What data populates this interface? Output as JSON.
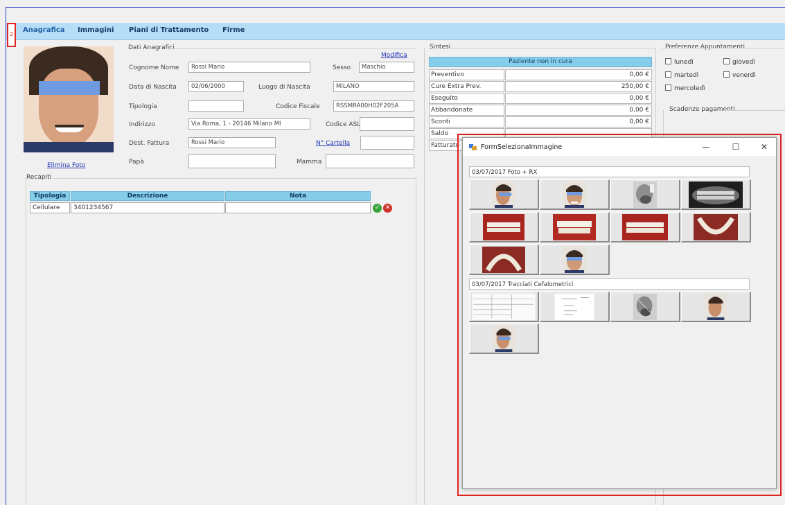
{
  "tabs": {
    "marker": "2",
    "items": [
      "Anagrafica",
      "Immagini",
      "Piani di Trattamento",
      "Firme"
    ]
  },
  "photo": {
    "delete_label": "Elimina Foto"
  },
  "anagrafica": {
    "group_label": "Dati Anagrafici",
    "edit_link": "Modifica",
    "cognome_nome_label": "Cognome Nome",
    "cognome_nome_value": "Rossi Mario",
    "sesso_label": "Sesso",
    "sesso_value": "Maschio",
    "data_nascita_label": "Data di Nascita",
    "data_nascita_value": "02/06/2000",
    "luogo_nascita_label": "Luogo di Nascita",
    "luogo_nascita_value": "MILANO",
    "tipologia_label": "Tipologia",
    "tipologia_value": "",
    "codice_fiscale_label": "Codice Fiscale",
    "codice_fiscale_value": "RSSMRA00H02F205A",
    "indirizzo_label": "Indirizzo",
    "indirizzo_value": "Via Roma, 1 - 20146 Milano MI",
    "codice_asl_label": "Codice ASL",
    "codice_asl_value": "",
    "dest_fattura_label": "Dest. Fattura",
    "dest_fattura_value": "Rossi Mario",
    "cartella_link": "N° Cartella",
    "cartella_value": "",
    "papa_label": "Papà",
    "papa_value": "",
    "mamma_label": "Mamma",
    "mamma_value": ""
  },
  "recapiti": {
    "group_label": "Recapiti",
    "columns": [
      "Tipologia",
      "Descrizione",
      "Nota"
    ],
    "rows": [
      {
        "tipologia": "Cellulare",
        "descrizione": "3401234567",
        "nota": ""
      }
    ]
  },
  "sintesi": {
    "group_label": "Sintesi",
    "status": "Paziente non in cura",
    "rows": [
      {
        "label": "Preventivo",
        "value": "0,00 €"
      },
      {
        "label": "Cure Extra Prev.",
        "value": "250,00 €"
      },
      {
        "label": "Eseguito",
        "value": "0,00 €"
      },
      {
        "label": "Abbandonate",
        "value": "0,00 €"
      },
      {
        "label": "Sconti",
        "value": "0,00 €"
      },
      {
        "label": "Saldo",
        "value": ""
      },
      {
        "label": "Fatturato",
        "value": ""
      }
    ]
  },
  "preferenze": {
    "group_label": "Preferenze Appuntamenti",
    "days": [
      "lunedì",
      "giovedì",
      "martedì",
      "venerdì",
      "mercoledì"
    ]
  },
  "scadenze": {
    "group_label": "Scadenze pagamenti"
  },
  "dialog": {
    "title": "FormSelezionaImmagine",
    "minimize": "—",
    "maximize": "☐",
    "close": "✕",
    "section1": "03/07/2017 Foto + RX",
    "section2": "03/07/2017 Tracciati Cefalometrici"
  },
  "colors": {
    "accent": "#2a3cc8",
    "tab_bar": "#b7ddf7",
    "header": "#86cde9",
    "highlight": "#e0241f"
  }
}
